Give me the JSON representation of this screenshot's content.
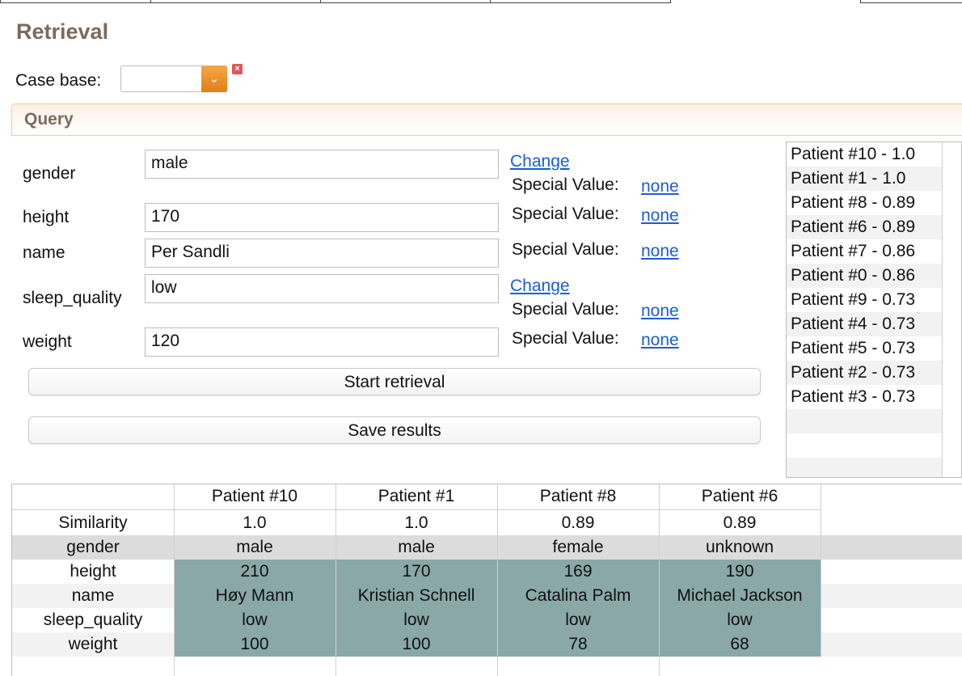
{
  "title": "Retrieval",
  "case_base": {
    "label": "Case base:",
    "value": "",
    "clear_icon": "close-icon",
    "arrow_icon": "chevron-down-icon"
  },
  "query": {
    "title": "Query",
    "change_label": "Change",
    "special_value_label": "Special Value:",
    "fields": [
      {
        "name": "gender",
        "value": "male",
        "special": "none"
      },
      {
        "name": "height",
        "value": "170",
        "special": "none"
      },
      {
        "name": "name",
        "value": "Per Sandli",
        "special": "none"
      },
      {
        "name": "sleep_quality",
        "value": "low",
        "special": "none"
      },
      {
        "name": "weight",
        "value": "120",
        "special": "none"
      }
    ]
  },
  "buttons": {
    "start": "Start retrieval",
    "save": "Save results"
  },
  "results": [
    "Patient #10 - 1.0",
    "Patient #1 - 1.0",
    "Patient #8 - 0.89",
    "Patient #6 - 0.89",
    "Patient #7 - 0.86",
    "Patient #0 - 0.86",
    "Patient #9 - 0.73",
    "Patient #4 - 0.73",
    "Patient #5 - 0.73",
    "Patient #2 - 0.73",
    "Patient #3 - 0.73"
  ],
  "comparison": {
    "columns": [
      "Patient #10",
      "Patient #1",
      "Patient #8",
      "Patient #6"
    ],
    "rows": [
      {
        "label": "Similarity",
        "values": [
          "1.0",
          "1.0",
          "0.89",
          "0.89"
        ]
      },
      {
        "label": "gender",
        "values": [
          "male",
          "male",
          "female",
          "unknown"
        ]
      },
      {
        "label": "height",
        "values": [
          "210",
          "170",
          "169",
          "190"
        ]
      },
      {
        "label": "name",
        "values": [
          "Høy Mann",
          "Kristian Schnell",
          "Catalina Palm",
          "Michael Jackson"
        ]
      },
      {
        "label": "sleep_quality",
        "values": [
          "low",
          "low",
          "low",
          "low"
        ]
      },
      {
        "label": "weight",
        "values": [
          "100",
          "100",
          "78",
          "68"
        ]
      }
    ]
  },
  "colors": {
    "title": "#7b6b5c",
    "link": "#1a5fd1",
    "accent": "#e88f20",
    "highlight": "#8aa8a8",
    "gender_row": "#dcdcdc"
  }
}
